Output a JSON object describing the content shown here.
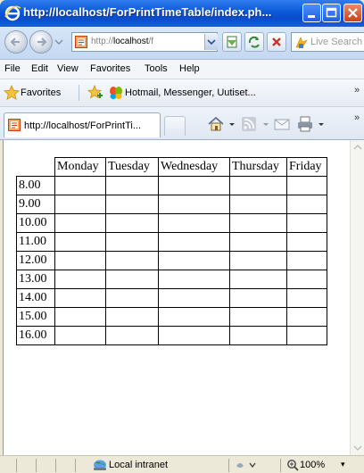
{
  "window": {
    "title": "http://localhost/ForPrintTimeTable/index.ph..."
  },
  "address_bar": {
    "url_prefix": "http://",
    "url_host": "localhost",
    "url_suffix": "/f",
    "search_placeholder": "Live Search"
  },
  "menu": {
    "items": [
      "File",
      "Edit",
      "View",
      "Favorites",
      "Tools",
      "Help"
    ]
  },
  "favorites_bar": {
    "label": "Favorites",
    "link": "Hotmail, Messenger, Uutiset...",
    "overflow": "»"
  },
  "tabs": {
    "active_label": "http://localhost/ForPrintTi...",
    "overflow": "»"
  },
  "timetable": {
    "days": [
      "Monday",
      "Tuesday",
      "Wednesday",
      "Thursday",
      "Friday"
    ],
    "times": [
      "8.00",
      "9.00",
      "10.00",
      "11.00",
      "12.00",
      "13.00",
      "14.00",
      "15.00",
      "16.00"
    ]
  },
  "status_bar": {
    "zone": "Local intranet",
    "zoom": "100%",
    "zoom_drop": "▾"
  },
  "colors": {
    "title_bar": "#0b58d8",
    "chrome": "#ece9d8",
    "page_background": "#ffffff"
  }
}
